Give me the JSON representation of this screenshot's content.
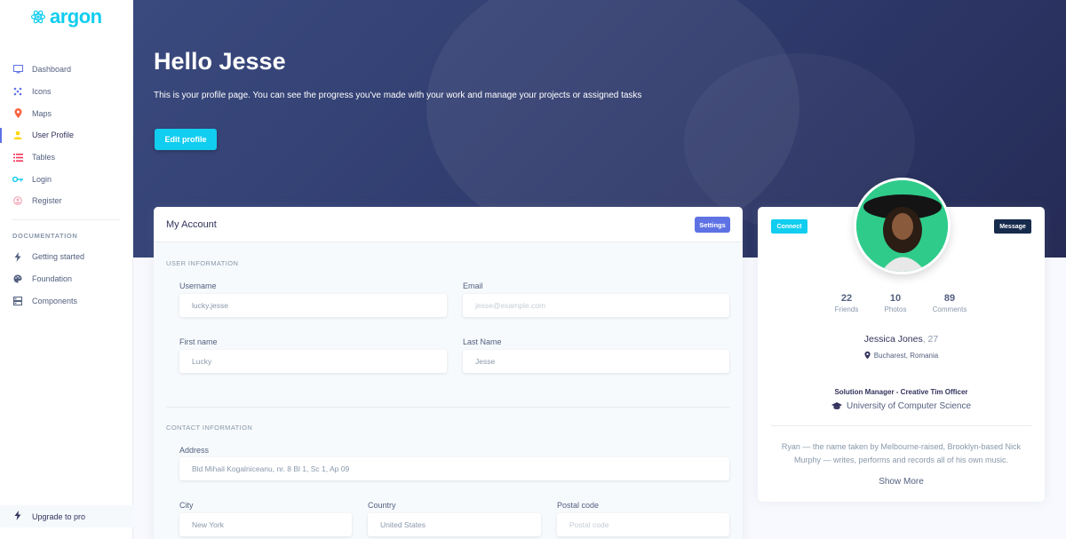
{
  "brand": {
    "name": "argon"
  },
  "sidebar": {
    "items": [
      {
        "label": "Dashboard",
        "icon": "monitor-icon",
        "color": "#5e72e4"
      },
      {
        "label": "Icons",
        "icon": "planet-icon",
        "color": "#5e72e4"
      },
      {
        "label": "Maps",
        "icon": "pin-icon",
        "color": "#fb6340"
      },
      {
        "label": "User Profile",
        "icon": "user-icon",
        "color": "#ffd600",
        "active": true
      },
      {
        "label": "Tables",
        "icon": "list-icon",
        "color": "#f5365c"
      },
      {
        "label": "Login",
        "icon": "key-icon",
        "color": "#11cdef"
      },
      {
        "label": "Register",
        "icon": "circle-user-icon",
        "color": "#f3a4b5"
      }
    ],
    "documentation_heading": "DOCUMENTATION",
    "doc_items": [
      {
        "label": "Getting started",
        "icon": "lightning-icon"
      },
      {
        "label": "Foundation",
        "icon": "palette-icon"
      },
      {
        "label": "Components",
        "icon": "components-icon"
      }
    ],
    "upgrade_label": "Upgrade to pro"
  },
  "header": {
    "greeting": "Hello Jesse",
    "intro": "This is your profile page. You can see the progress you've made with your work and manage your projects or assigned tasks",
    "edit_label": "Edit profile"
  },
  "account": {
    "title": "My Account",
    "settings_label": "Settings",
    "user_info_heading": "USER INFORMATION",
    "username_label": "Username",
    "username_value": "lucky.jesse",
    "email_label": "Email",
    "email_placeholder": "jesse@example.com",
    "first_name_label": "First name",
    "first_name_value": "Lucky",
    "last_name_label": "Last Name",
    "last_name_value": "Jesse",
    "contact_heading": "CONTACT INFORMATION",
    "address_label": "Address",
    "address_value": "Bld Mihail Kogalniceanu, nr. 8 Bl 1, Sc 1, Ap 09",
    "city_label": "City",
    "city_value": "New York",
    "country_label": "Country",
    "country_value": "United States",
    "postal_label": "Postal code",
    "postal_placeholder": "Postal code"
  },
  "profile": {
    "connect_label": "Connect",
    "message_label": "Message",
    "stats": [
      {
        "value": "22",
        "label": "Friends"
      },
      {
        "value": "10",
        "label": "Photos"
      },
      {
        "value": "89",
        "label": "Comments"
      }
    ],
    "name": "Jessica Jones",
    "age": ", 27",
    "location": "Bucharest, Romania",
    "job": "Solution Manager - Creative Tim Officer",
    "university": "University of Computer Science",
    "bio": "Ryan — the name taken by Melbourne-raised, Brooklyn-based Nick Murphy — writes, performs and records all of his own music.",
    "show_more": "Show More"
  }
}
